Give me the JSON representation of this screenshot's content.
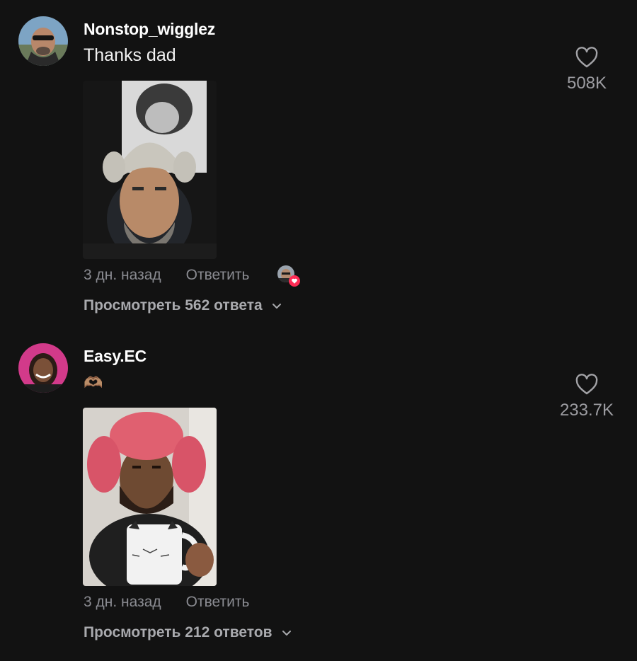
{
  "comments": [
    {
      "username": "Nonstop_wigglez",
      "text": "Thanks dad",
      "time": "3 дн. назад",
      "reply_label": "Ответить",
      "likes": "508K",
      "view_replies": "Просмотреть 562 ответа",
      "liked_by_creator": true
    },
    {
      "username": "Easy.EC",
      "text": "🫶🏽",
      "time": "3 дн. назад",
      "reply_label": "Ответить",
      "likes": "233.7K",
      "view_replies": "Просмотреть 212 ответов",
      "liked_by_creator": false
    }
  ],
  "icons": {
    "like": "heart-outline-icon",
    "expand": "chevron-down-icon",
    "creator_like": "heart-filled-icon"
  },
  "colors": {
    "background": "#121212",
    "secondary_text": "#8a8b91",
    "creator_heart": "#fe2c55"
  }
}
